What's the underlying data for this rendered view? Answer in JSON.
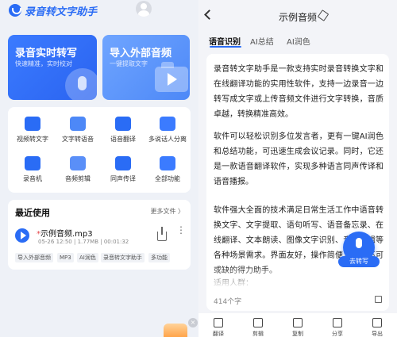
{
  "left": {
    "app_title": "录音转文字助手",
    "cards": [
      {
        "title": "录音实时转写",
        "subtitle": "快速精准，实时校对"
      },
      {
        "title": "导入外部音频",
        "subtitle": "一键提取文字"
      }
    ],
    "tools": [
      {
        "label": "视频转文字",
        "icon": "video-to-text-icon",
        "color": "#2a6cf5"
      },
      {
        "label": "文字转语音",
        "icon": "text-to-speech-icon",
        "color": "#4d88f7"
      },
      {
        "label": "语音翻译",
        "icon": "voice-translate-icon",
        "color": "#2a6cf5"
      },
      {
        "label": "多说话人分离",
        "icon": "speaker-separation-icon",
        "color": "#3b7bff"
      },
      {
        "label": "录音机",
        "icon": "recorder-icon",
        "color": "#2a6cf5"
      },
      {
        "label": "音频剪辑",
        "icon": "audio-cut-icon",
        "color": "#5a8ff8"
      },
      {
        "label": "同声传译",
        "icon": "simultaneous-interpretation-icon",
        "color": "#2a6cf5"
      },
      {
        "label": "全部功能",
        "icon": "all-functions-icon",
        "color": "#3b7bff"
      }
    ],
    "recent": {
      "title": "最近使用",
      "more": "更多文件 〉",
      "file": {
        "star": "*",
        "name": "示例音频.mp3",
        "date": "05-26 12:50",
        "size": "1.77MB",
        "duration": "00:01:32"
      },
      "tags": [
        "导入外部音频",
        "MP3",
        "AI润色",
        "录音转文字助手",
        "多功能"
      ]
    },
    "float_close": "×"
  },
  "right": {
    "title": "示例音频",
    "tabs": [
      "语音识别",
      "AI总结",
      "AI润色"
    ],
    "active_tab": "语音识别",
    "paragraphs": [
      "录音转文字助手是一款支持实时录音转换文字和在线翻译功能的实用性软件，支持一边录音一边转写成文字或上传音频文件进行文字转换，音质卓越，转换精准高效。",
      "软件可以轻松识别多位发言者，更有一键AI润色和总结功能，可迅速生成会议记录。同时，它还是一款语音翻译软件，实现多种语言同声传译和语音播报。",
      "软件强大全面的技术满足日常生活工作中语音转换文字、文字提取、语句听写、语音备忘录、在线翻译、文本朗读、图像文字识别、音频剪辑等各种场景需求。界面友好，操作简便，是您不可或缺的得力助手。",
      "适用人群："
    ],
    "char_count": "414个字",
    "fab_label": "去转写",
    "bottom_actions": [
      {
        "label": "翻译",
        "icon": "translate-icon"
      },
      {
        "label": "剪辑",
        "icon": "clip-icon"
      },
      {
        "label": "复制",
        "icon": "copy-icon"
      },
      {
        "label": "分享",
        "icon": "share-icon"
      },
      {
        "label": "导出",
        "icon": "export-icon"
      }
    ]
  }
}
